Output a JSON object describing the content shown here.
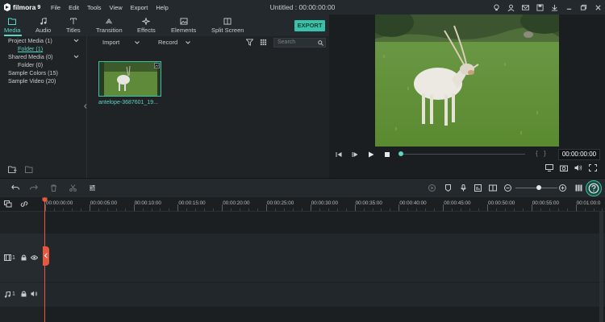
{
  "app": {
    "logo_text": "filmora",
    "logo_num": "9",
    "title": "Untitled : 00:00:00:00"
  },
  "menu": [
    "File",
    "Edit",
    "Tools",
    "View",
    "Export",
    "Help"
  ],
  "tabs": [
    {
      "label": "Media",
      "icon": "folder-icon"
    },
    {
      "label": "Audio",
      "icon": "music-note-icon"
    },
    {
      "label": "Titles",
      "icon": "text-icon"
    },
    {
      "label": "Transition",
      "icon": "transition-icon"
    },
    {
      "label": "Effects",
      "icon": "sparkle-icon"
    },
    {
      "label": "Elements",
      "icon": "image-icon"
    },
    {
      "label": "Split Screen",
      "icon": "split-screen-icon"
    }
  ],
  "export_label": "EXPORT",
  "folders": {
    "project_media": "Project Media (1)",
    "folder_1": "Folder (1)",
    "shared_media": "Shared Media (0)",
    "folder_0": "Folder (0)",
    "sample_colors": "Sample Colors (15)",
    "sample_video": "Sample Video (20)"
  },
  "toolbar": {
    "import_label": "Import",
    "record_label": "Record",
    "search_placeholder": "Search"
  },
  "media_item": {
    "label": "antelope-3687601_19..."
  },
  "preview": {
    "timecode": "00:00:00:00",
    "progress": 0
  },
  "ruler_ticks": [
    "00:00:00:00",
    "00:00:05:00",
    "00:00:10:00",
    "00:00:15:00",
    "00:00:20:00",
    "00:00:25:00",
    "00:00:30:00",
    "00:00:35:00",
    "00:00:40:00",
    "00:00:45:00",
    "00:00:50:00",
    "00:00:55:00",
    "00:01:00:0"
  ],
  "tracks": {
    "video_num": "1",
    "audio_num": "1"
  },
  "colors": {
    "accent": "#39c2a8",
    "playhead": "#e9573f"
  }
}
